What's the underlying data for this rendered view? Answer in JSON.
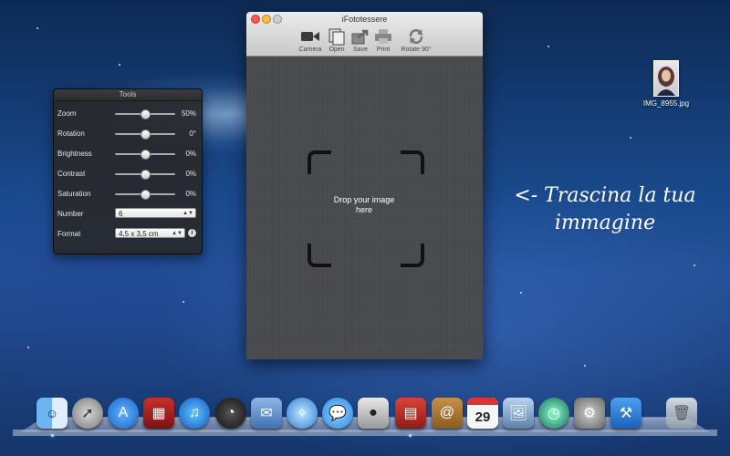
{
  "window": {
    "title": "iFototessere",
    "toolbar": [
      {
        "label": "Camera",
        "icon": "camera-icon"
      },
      {
        "label": "Open",
        "icon": "open-icon"
      },
      {
        "label": "Save",
        "icon": "save-icon"
      },
      {
        "label": "Print",
        "icon": "print-icon"
      },
      {
        "label": "Rotate 90°",
        "icon": "rotate-icon"
      }
    ],
    "drop_line1": "Drop your image",
    "drop_line2": "here"
  },
  "tools": {
    "title": "Tools",
    "sliders": [
      {
        "label": "Zoom",
        "value": "50%",
        "level": 0.5
      },
      {
        "label": "Rotation",
        "value": "0°",
        "level": 0.5
      },
      {
        "label": "Brightness",
        "value": "0%",
        "level": 0.5
      },
      {
        "label": "Contrast",
        "value": "0%",
        "level": 0.5
      },
      {
        "label": "Saturation",
        "value": "0%",
        "level": 0.5
      }
    ],
    "number": {
      "label": "Number",
      "value": "6"
    },
    "format": {
      "label": "Format",
      "value": "4,5 x 3,5 cm"
    }
  },
  "desktop": {
    "hint_line1": "<- Trascina la tua",
    "hint_line2": "immagine",
    "file_name": "IMG_8955.jpg"
  },
  "dock": {
    "icons": [
      "finder-icon",
      "launchpad-icon",
      "app-store-icon",
      "photo-booth-icon",
      "itunes-icon",
      "dashboard-icon",
      "mail-icon",
      "safari-icon",
      "messages-icon",
      "facetime-icon",
      "ifototessere-icon",
      "contacts-icon",
      "calendar-icon",
      "preview-icon",
      "time-machine-icon",
      "system-preferences-icon",
      "xcode-icon",
      "trash-icon"
    ],
    "calendar_day": "29"
  },
  "colors": {
    "close": "#fc5753",
    "minimize": "#fdbc40",
    "zoom": "#d0d0d0"
  }
}
